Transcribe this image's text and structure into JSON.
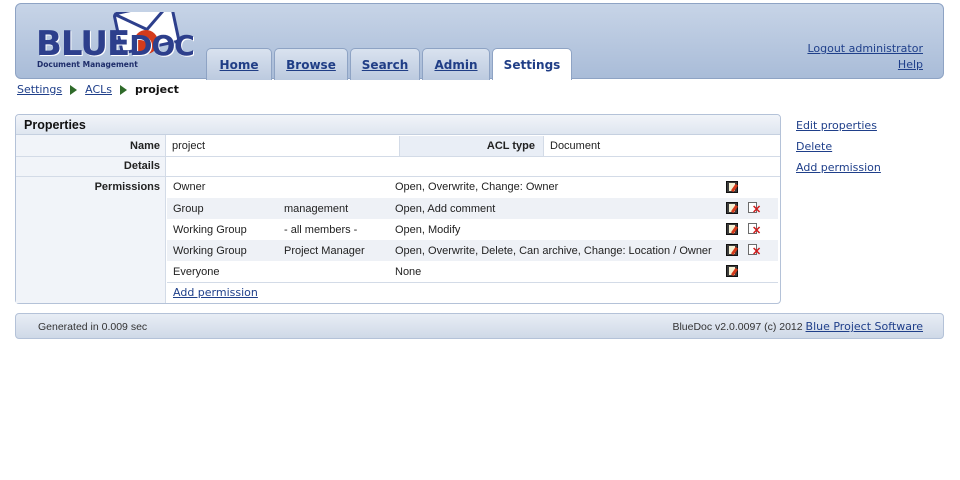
{
  "header": {
    "logo_word_1": "BLUE",
    "logo_word_2": "DOC",
    "logo_subtitle": "Document Management",
    "tabs": [
      {
        "label": "Home"
      },
      {
        "label": "Browse"
      },
      {
        "label": "Search"
      },
      {
        "label": "Admin"
      },
      {
        "label": "Settings",
        "active": true
      }
    ],
    "logout_label": "Logout administrator",
    "help_label": "Help"
  },
  "breadcrumb": {
    "items": [
      "Settings",
      "ACLs"
    ],
    "current": "project"
  },
  "panel": {
    "title": "Properties",
    "name_label": "Name",
    "name_value": "project",
    "acl_type_label": "ACL type",
    "acl_type_value": "Document",
    "details_label": "Details",
    "permissions_label": "Permissions",
    "permissions": [
      {
        "subject": "Owner",
        "qualifier": "",
        "rights": "Open, Overwrite, Change: Owner",
        "deletable": false
      },
      {
        "subject": "Group",
        "qualifier": "management",
        "rights": "Open, Add comment",
        "deletable": true
      },
      {
        "subject": "Working Group",
        "qualifier": "- all members -",
        "rights": "Open, Modify",
        "deletable": true
      },
      {
        "subject": "Working Group",
        "qualifier": "Project Manager",
        "rights": "Open, Overwrite, Delete, Can archive, Change: Location / Owner",
        "deletable": true
      },
      {
        "subject": "Everyone",
        "qualifier": "",
        "rights": "None",
        "deletable": false
      }
    ],
    "add_permission_label": "Add permission"
  },
  "side_actions": {
    "edit_properties": "Edit properties",
    "delete": "Delete",
    "add_permission": "Add permission"
  },
  "footer": {
    "generated": "Generated in 0.009 sec",
    "version": "BlueDoc v2.0.0097 (c) 2012",
    "company_link": "Blue Project Software"
  },
  "colors": {
    "header_bg": "#b5c6df",
    "link": "#1f3f8a",
    "breadcrumb_arrow": "#2f6b2a"
  }
}
